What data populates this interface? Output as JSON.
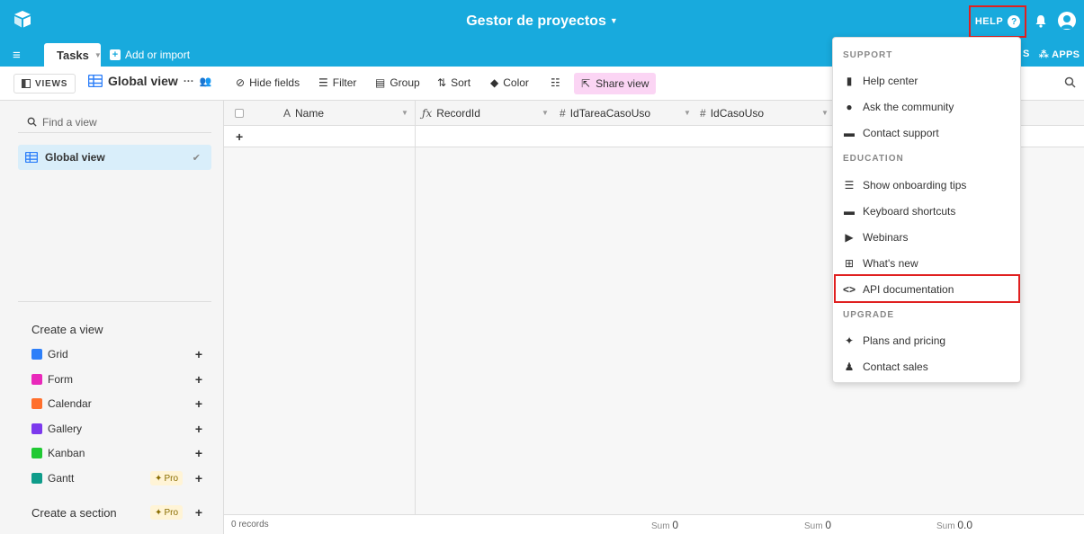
{
  "header": {
    "base_title": "Gestor de proyectos",
    "help_label": "HELP",
    "bg_color": "#18aadd"
  },
  "tabs": {
    "active_table": "Tasks",
    "add_import": "Add or import",
    "apps_prefix": "S",
    "apps_label": "APPS"
  },
  "toolbar": {
    "views_label": "VIEWS",
    "view_name": "Global view",
    "hide_fields": "Hide fields",
    "filter": "Filter",
    "group": "Group",
    "sort": "Sort",
    "color": "Color",
    "share_view": "Share view"
  },
  "sidebar": {
    "find_placeholder": "Find a view",
    "current_view": "Global view",
    "create_view_title": "Create a view",
    "create_items": [
      {
        "label": "Grid",
        "color": "#2d7ff9"
      },
      {
        "label": "Form",
        "color": "#e929ba"
      },
      {
        "label": "Calendar",
        "color": "#ff6f2c"
      },
      {
        "label": "Gallery",
        "color": "#7c39ed"
      },
      {
        "label": "Kanban",
        "color": "#20c933"
      },
      {
        "label": "Gantt",
        "color": "#0f9c8a"
      }
    ],
    "pro_label": "Pro",
    "create_section": "Create a section"
  },
  "grid": {
    "columns": [
      {
        "name": "Name",
        "icon": "A"
      },
      {
        "name": "RecordId",
        "icon": "fx"
      },
      {
        "name": "IdTareaCasoUso",
        "icon": "#"
      },
      {
        "name": "IdCasoUso",
        "icon": "#"
      }
    ],
    "records_count": "0 records",
    "sum_label": "Sum",
    "sums": [
      "0",
      "0",
      "0.0"
    ]
  },
  "help_menu": {
    "support_title": "SUPPORT",
    "support_items": [
      "Help center",
      "Ask the community",
      "Contact support"
    ],
    "education_title": "EDUCATION",
    "education_items": [
      "Show onboarding tips",
      "Keyboard shortcuts",
      "Webinars",
      "What's new",
      "API documentation"
    ],
    "upgrade_title": "UPGRADE",
    "upgrade_items": [
      "Plans and pricing",
      "Contact sales"
    ]
  }
}
